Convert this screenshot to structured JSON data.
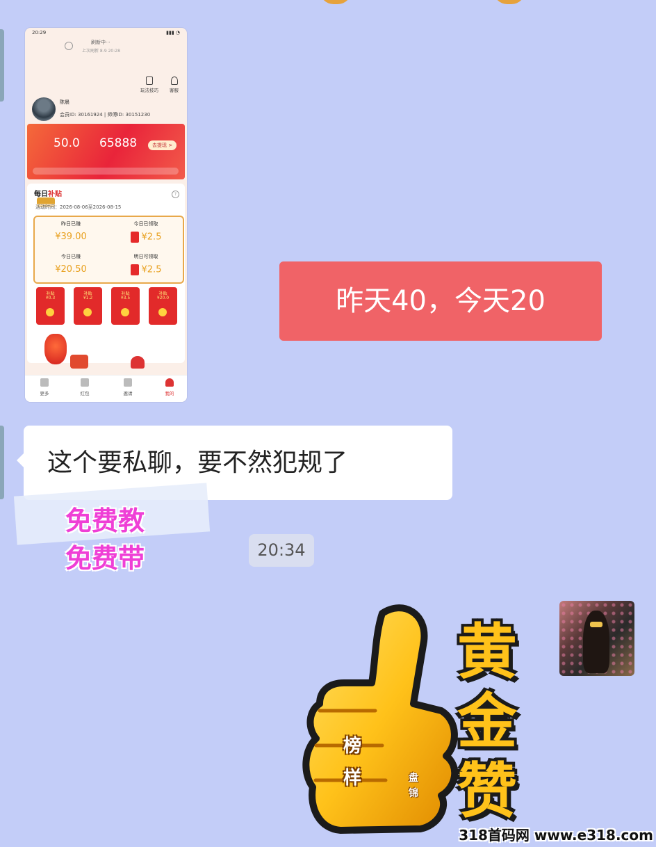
{
  "phone_screenshot": {
    "status_time": "20:29",
    "refresh_text": "刷新中···",
    "last_refresh": "上次刷新 8-9 20:28",
    "tools": [
      {
        "label": "玩法技巧"
      },
      {
        "label": "客服"
      }
    ],
    "user_name": "陈晨",
    "ids": "会员ID: 30161924 | 师傅ID: 30151230",
    "banner": {
      "value1": "50.0",
      "value2": "65888",
      "withdraw_label": "去提现 >"
    },
    "daily_title_a": "每日",
    "daily_title_b": "补贴",
    "period": "活动时间：2026-08-06至2026-08-15",
    "stats": [
      {
        "label": "昨日已赚",
        "value": "¥39.00"
      },
      {
        "label": "今日已领取",
        "value": "¥2.5"
      },
      {
        "label": "今日已赚",
        "value": "¥20.50"
      },
      {
        "label": "明日可领取",
        "value": "¥2.5"
      }
    ],
    "subsidies": [
      {
        "title": "补贴",
        "amount": "¥0.3"
      },
      {
        "title": "补贴",
        "amount": "¥1.2"
      },
      {
        "title": "补贴",
        "amount": "¥3.5"
      },
      {
        "title": "补贴",
        "amount": "¥20.0"
      }
    ],
    "nav": [
      {
        "label": "更多"
      },
      {
        "label": "红包"
      },
      {
        "label": "邀请"
      },
      {
        "label": "我的"
      }
    ]
  },
  "messages": {
    "right_text": "昨天40，今天20",
    "left_text": "这个要私聊，要不然犯规了",
    "timestamp": "20:34"
  },
  "free_banner": {
    "line1": "免费教",
    "line2": "免费带"
  },
  "sticker": {
    "chars": [
      "黄",
      "金",
      "赞"
    ],
    "thumb_label_1": "榜",
    "thumb_label_2": "样",
    "thumb_label_small_1": "盘",
    "thumb_label_small_2": "锦"
  },
  "watermark": "318首码网 www.e318.com",
  "colors": {
    "background": "#c3cdf8",
    "right_bubble": "#f06367",
    "left_bubble": "#ffffff",
    "free_text": "#ef3fd6",
    "gold": "#ffc21a"
  }
}
